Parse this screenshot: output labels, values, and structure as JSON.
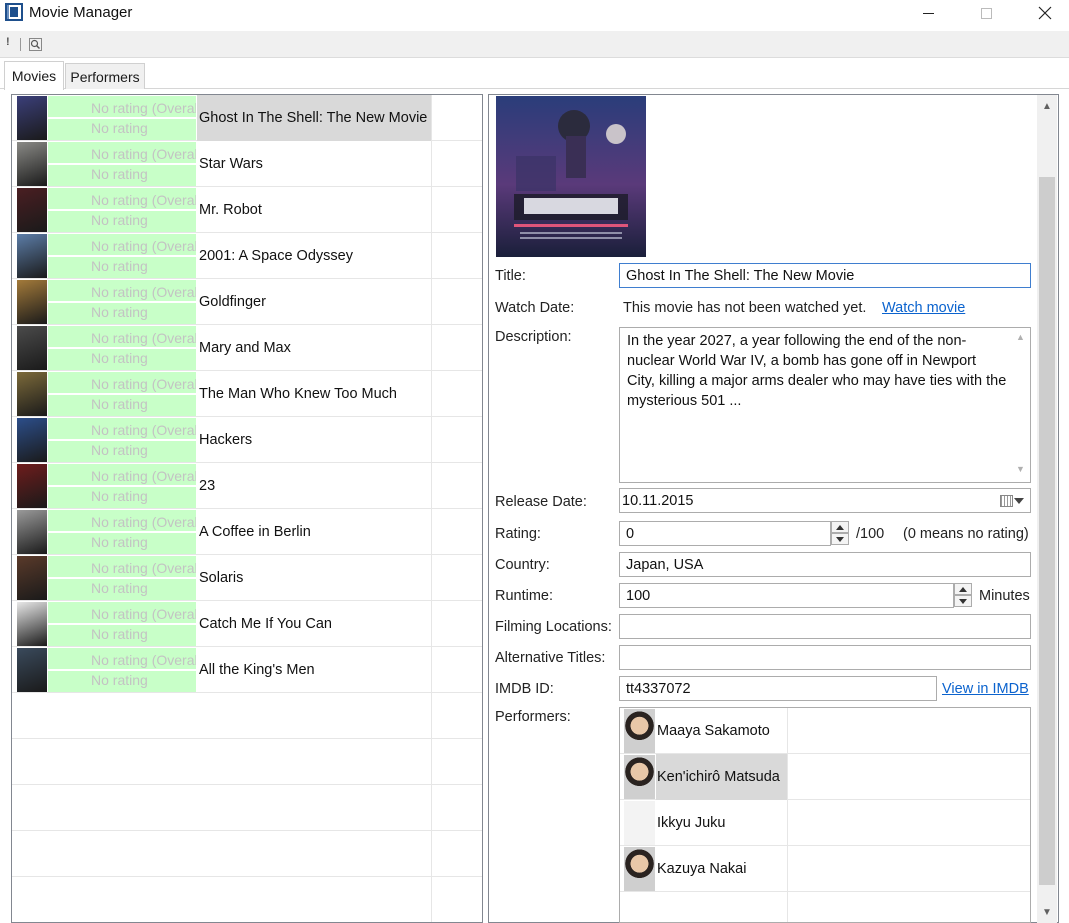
{
  "window": {
    "title": "Movie Manager"
  },
  "tabs": [
    {
      "label": "Movies"
    },
    {
      "label": "Performers"
    }
  ],
  "rating_placeholder": {
    "overall": "No rating (Overall)",
    "personal": "No rating"
  },
  "movies": [
    {
      "title": "Ghost In The Shell: The New Movie",
      "poster_color": "#3b3f7a"
    },
    {
      "title": "Star Wars",
      "poster_color": "#8a8a86"
    },
    {
      "title": "Mr. Robot",
      "poster_color": "#4a1e22"
    },
    {
      "title": "2001: A Space Odyssey",
      "poster_color": "#5c7da8"
    },
    {
      "title": "Goldfinger",
      "poster_color": "#a37a3a"
    },
    {
      "title": "Mary and Max",
      "poster_color": "#4b4b4b"
    },
    {
      "title": "The Man Who Knew Too Much",
      "poster_color": "#7c6a3a"
    },
    {
      "title": "Hackers",
      "poster_color": "#2c4e8a"
    },
    {
      "title": "23",
      "poster_color": "#6e1c1c"
    },
    {
      "title": "A Coffee in Berlin",
      "poster_color": "#9a9a9a"
    },
    {
      "title": "Solaris",
      "poster_color": "#5a3a2a"
    },
    {
      "title": "Catch Me If You Can",
      "poster_color": "#e8e8e8"
    },
    {
      "title": "All the King's Men",
      "poster_color": "#3a4a5c"
    }
  ],
  "detail": {
    "labels": {
      "title": "Title:",
      "watch_date": "Watch Date:",
      "description": "Description:",
      "release_date": "Release Date:",
      "rating": "Rating:",
      "country": "Country:",
      "runtime": "Runtime:",
      "filming_locations": "Filming Locations:",
      "alternative_titles": "Alternative Titles:",
      "imdb_id": "IMDB ID:",
      "performers": "Performers:"
    },
    "title": "Ghost In The Shell: The New Movie",
    "watch_status": "This movie has not been watched yet.",
    "watch_link": "Watch movie",
    "description": "In the year 2027, a year following the end of the non-nuclear World War IV, a bomb has gone off in Newport City, killing a major arms dealer who may have ties with the mysterious 501 ...",
    "release_date": "10.11.2015",
    "rating": "0",
    "rating_suffix": "/100",
    "rating_hint": "(0 means no rating)",
    "country": "Japan, USA",
    "runtime": "100",
    "runtime_unit": "Minutes",
    "filming_locations": "",
    "alternative_titles": "",
    "imdb_id": "tt4337072",
    "imdb_link": "View in IMDB",
    "performers": [
      {
        "name": "Maaya Sakamoto",
        "avatar": "avatar-photo"
      },
      {
        "name": "Ken'ichirô Matsuda",
        "avatar": "avatar-photo"
      },
      {
        "name": "Ikkyu Juku",
        "avatar": "avatar-placeholder"
      },
      {
        "name": "Kazuya Nakai",
        "avatar": "avatar-photo"
      }
    ]
  }
}
